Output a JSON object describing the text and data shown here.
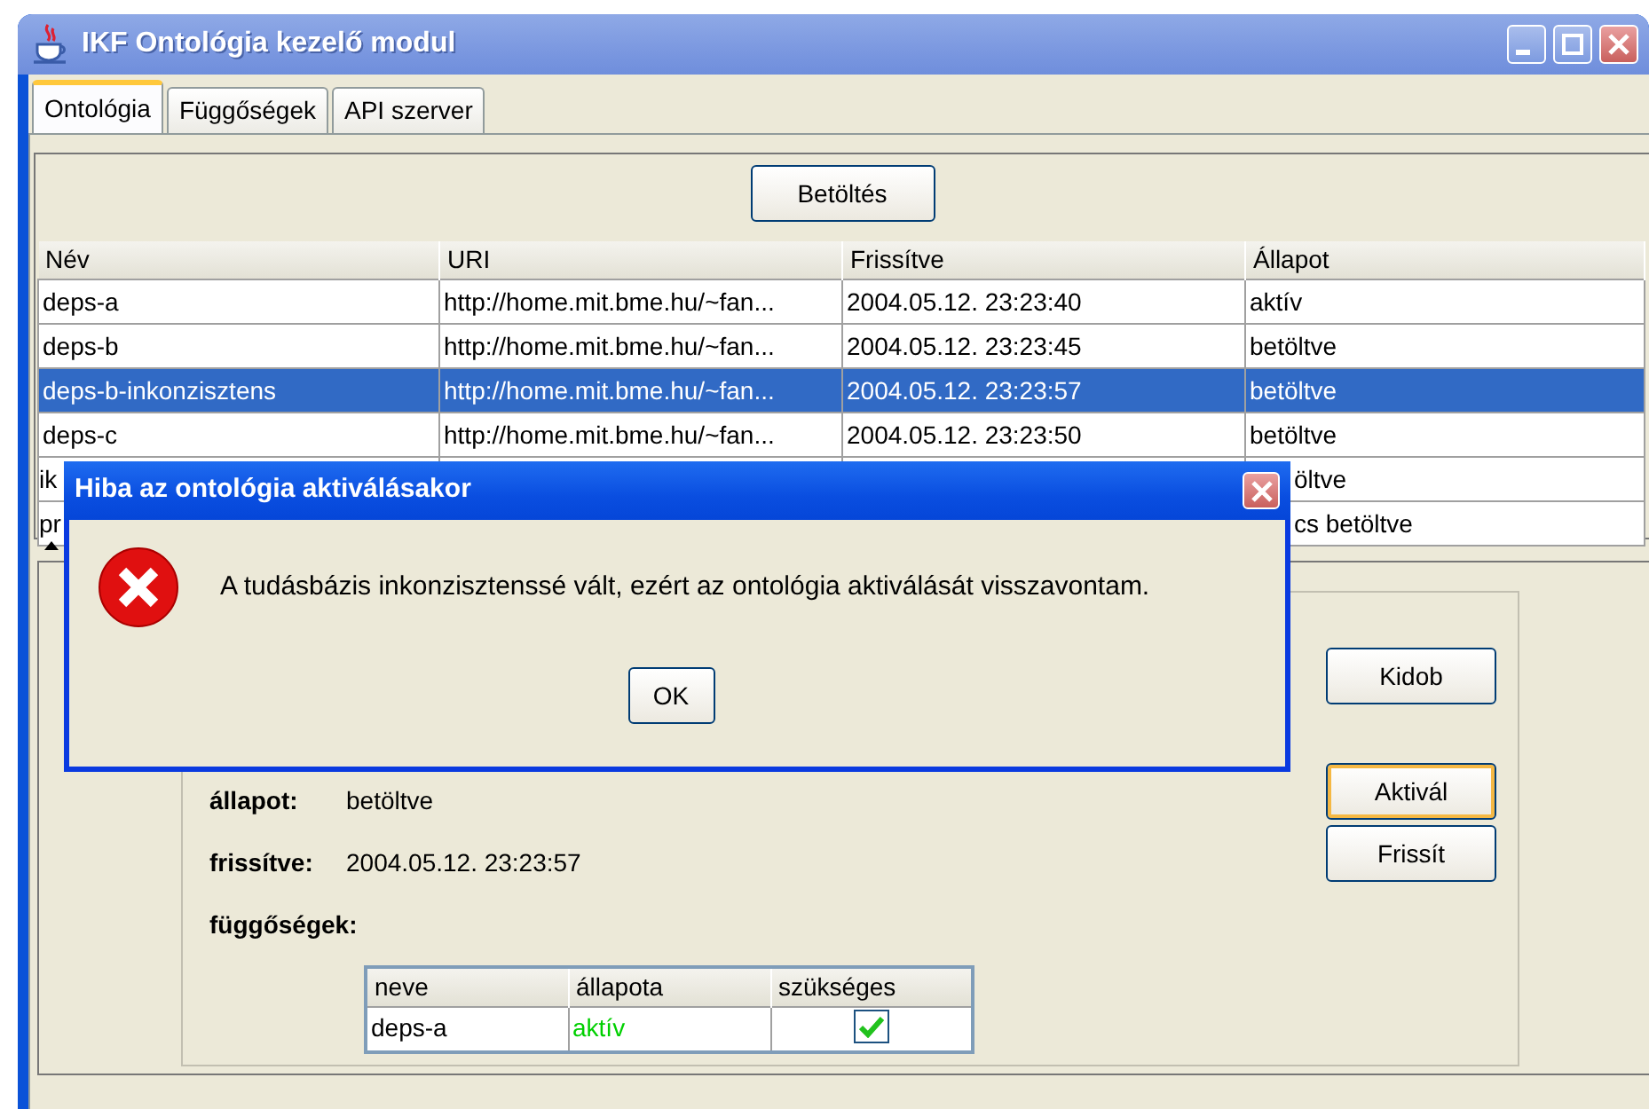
{
  "window": {
    "title": "IKF Ontológia kezelő modul"
  },
  "tabs": [
    {
      "label": "Ontológia",
      "selected": true
    },
    {
      "label": "Függőségek",
      "selected": false
    },
    {
      "label": "API szerver",
      "selected": false
    }
  ],
  "load_button": "Betöltés",
  "table": {
    "columns": [
      "Név",
      "URI",
      "Frissítve",
      "Állapot"
    ],
    "rows": [
      {
        "cells": [
          "deps-a",
          "http://home.mit.bme.hu/~fan...",
          "2004.05.12. 23:23:40",
          "aktív"
        ],
        "selected": false
      },
      {
        "cells": [
          "deps-b",
          "http://home.mit.bme.hu/~fan...",
          "2004.05.12. 23:23:45",
          "betöltve"
        ],
        "selected": false
      },
      {
        "cells": [
          "deps-b-inkonzisztens",
          "http://home.mit.bme.hu/~fan...",
          "2004.05.12. 23:23:57",
          "betöltve"
        ],
        "selected": true
      },
      {
        "cells": [
          "deps-c",
          "http://home.mit.bme.hu/~fan...",
          "2004.05.12. 23:23:50",
          "betöltve"
        ],
        "selected": false
      },
      {
        "cells": [
          "ik",
          null,
          null,
          "öltve"
        ],
        "selected": false
      },
      {
        "cells": [
          "pr",
          null,
          null,
          "cs betöltve"
        ],
        "selected": false
      }
    ]
  },
  "details": {
    "fields": [
      {
        "label": "állapot:",
        "value": "betöltve"
      },
      {
        "label": "frissítve:",
        "value": "2004.05.12. 23:23:57"
      }
    ],
    "dependencies_label": "függőségek:",
    "dependencies": {
      "columns": [
        "neve",
        "állapota",
        "szükséges"
      ],
      "rows": [
        {
          "name": "deps-a",
          "status": "aktív",
          "color": "#00d000",
          "required": true
        }
      ]
    },
    "buttons": [
      {
        "label": "Kidob",
        "focused": false
      },
      {
        "label": "Aktivál",
        "focused": true
      },
      {
        "label": "Frissít",
        "focused": false
      }
    ]
  },
  "dialog": {
    "title": "Hiba az ontológia aktiválásakor",
    "message": "A tudásbázis inkonzisztenssé vált, ezért az ontológia aktiválását visszavontam.",
    "button": "OK"
  }
}
